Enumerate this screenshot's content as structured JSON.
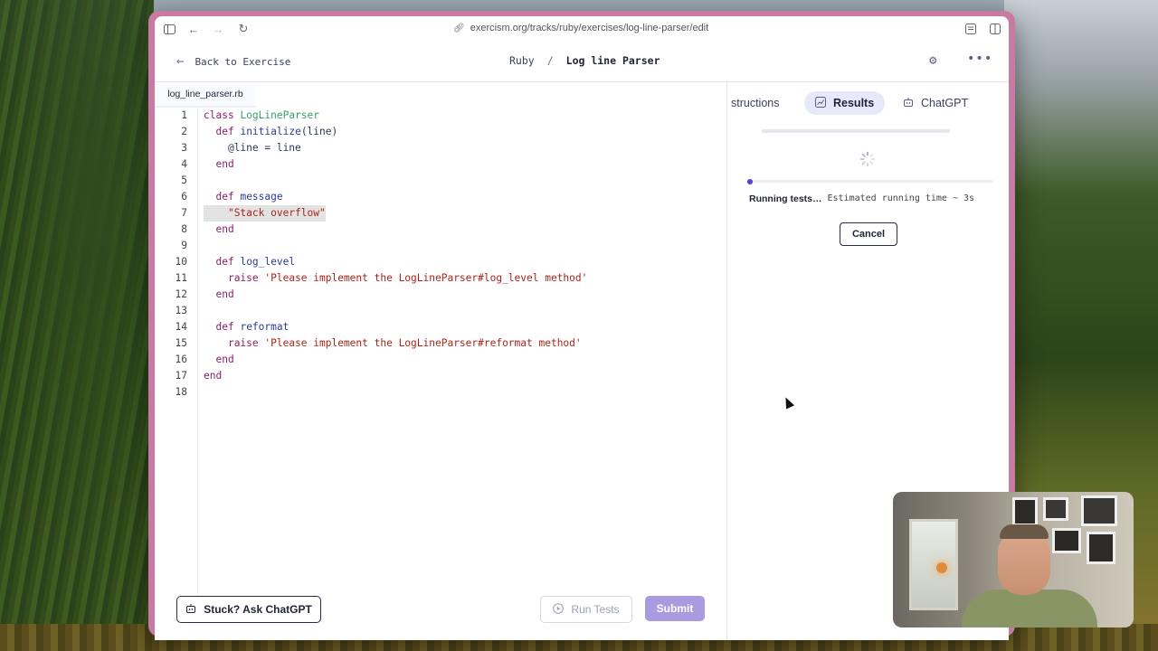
{
  "browser": {
    "url": "exercism.org/tracks/ruby/exercises/log-line-parser/edit"
  },
  "header": {
    "back_label": "Back to Exercise",
    "track": "Ruby",
    "separator": "/",
    "exercise": "Log line Parser"
  },
  "editor": {
    "filename": "log_line_parser.rb",
    "lines": [
      {
        "n": "1"
      },
      {
        "n": "2"
      },
      {
        "n": "3"
      },
      {
        "n": "4"
      },
      {
        "n": "5"
      },
      {
        "n": "6"
      },
      {
        "n": "7"
      },
      {
        "n": "8"
      },
      {
        "n": "9"
      },
      {
        "n": "10"
      },
      {
        "n": "11"
      },
      {
        "n": "12"
      },
      {
        "n": "13"
      },
      {
        "n": "14"
      },
      {
        "n": "15"
      },
      {
        "n": "16"
      },
      {
        "n": "17"
      },
      {
        "n": "18"
      }
    ],
    "tokens": {
      "class_kw": "class",
      "class_name": "LogLineParser",
      "def_kw": "def",
      "initialize": "initialize",
      "initialize_args": "(line)",
      "assign": "@line = line",
      "end_kw": "end",
      "message": "message",
      "message_str": "\"Stack overflow\"",
      "log_level": "log_level",
      "raise_kw": "raise",
      "log_level_str": "'Please implement the LogLineParser#log_level method'",
      "reformat": "reformat",
      "reformat_str": "'Please implement the LogLineParser#reformat method'"
    }
  },
  "footer": {
    "chatgpt_label": "Stuck? Ask ChatGPT",
    "run_tests_label": "Run Tests",
    "submit_label": "Submit"
  },
  "panel": {
    "tabs": [
      {
        "label": "structions"
      },
      {
        "label": "Results"
      },
      {
        "label": "ChatGPT"
      }
    ],
    "progress": 0.02,
    "running_label": "Running tests…",
    "estimate_label": "Estimated running time ~ 3s",
    "cancel_label": "Cancel"
  },
  "icons": {
    "sidebar": "sidebar-toggle-icon",
    "back": "back-arrow-icon",
    "forward": "forward-arrow-icon",
    "reload": "reload-icon",
    "link": "link-icon",
    "settings": "gear-icon",
    "more": "more-dots-icon",
    "spinner": "spinner-icon"
  },
  "colors": {
    "accent": "#5a3fd1",
    "submit": "#a99be0",
    "active_tab": "#e7e9fb",
    "window_border": "#c97aa2"
  }
}
